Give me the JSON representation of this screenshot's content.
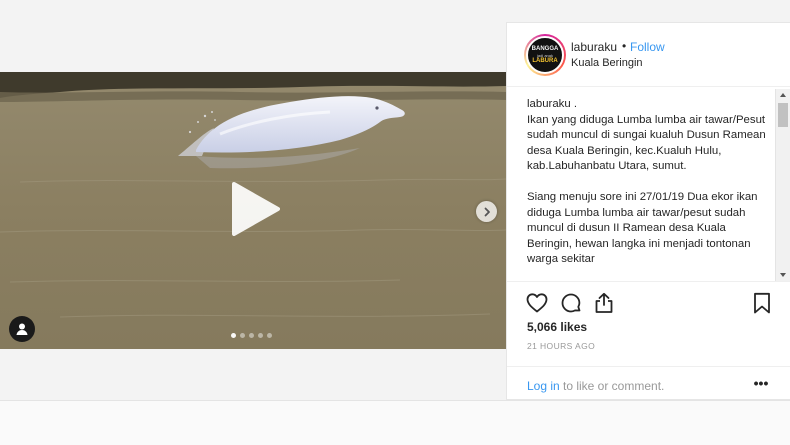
{
  "post": {
    "username": "laburaku",
    "follow_label": "Follow",
    "separator": "•",
    "location": "Kuala Beringin",
    "avatar": {
      "line1": "BANGGA",
      "line2": "jadi anak",
      "line3": "LABURA"
    },
    "caption": "laburaku .\nIkan yang diduga Lumba lumba air tawar/Pesut sudah muncul di sungai kualuh Dusun Ramean desa Kuala Beringin, kec.Kualuh Hulu, kab.Labuhanbatu Utara, sumut.\n\nSiang menuju sore ini 27/01/19 Dua ekor ikan diduga Lumba lumba air tawar/pesut sudah muncul di dusun II Ramean desa Kuala Beringin, hewan langka ini menjadi tontonan warga sekitar",
    "likes": "5,066 likes",
    "time": "21 HOURS AGO",
    "login_link": "Log in",
    "login_rest": "to like or comment.",
    "more_label": "•••"
  },
  "media": {
    "carousel_count": 5,
    "carousel_active": 0,
    "icons": {
      "play": "play-icon",
      "next": "chevron-right-icon",
      "user_tag": "user-tag-icon"
    }
  },
  "colors": {
    "accent": "#3897f0",
    "text": "#262626",
    "muted": "#999999"
  }
}
